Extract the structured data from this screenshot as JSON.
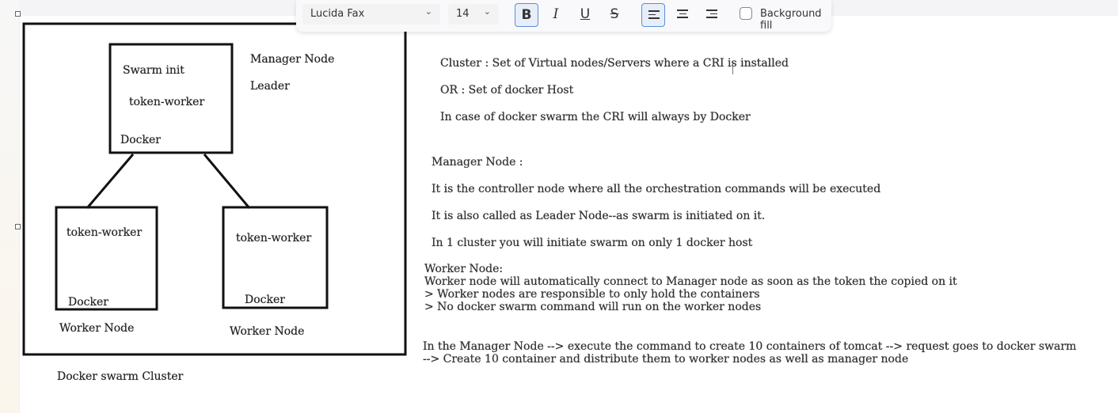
{
  "toolbar": {
    "font_family": "Lucida Fax",
    "font_size": "14",
    "bold_label": "B",
    "italic_label": "I",
    "underline_label": "U",
    "strike_label": "S",
    "background_fill_label": "Background fill",
    "icons": {
      "chevron": "chevron-down-icon",
      "align_left": "align-left-icon",
      "align_center": "align-center-icon",
      "align_right": "align-right-icon"
    },
    "accent_color": "#5b8ddb"
  },
  "diagram": {
    "manager_box": {
      "line1": "Swarm init",
      "line2": "token-worker",
      "line3": "Docker"
    },
    "manager_label": "Manager Node",
    "leader_label": "Leader",
    "worker_left": {
      "line1": "token-worker",
      "line2": "Docker",
      "caption": "Worker Node"
    },
    "worker_right": {
      "line1": "token-worker",
      "line2": "Docker",
      "caption": "Worker Node"
    },
    "cluster_caption": "Docker swarm Cluster"
  },
  "notes": {
    "cluster_def": "Cluster : Set of Virtual nodes/Servers where a CRI is installed",
    "cluster_or": "OR : Set of docker Host",
    "cluster_cri": "In case of docker swarm the CRI will always by Docker",
    "manager_heading": "Manager Node :",
    "manager_1": "It is the controller node where all the orchestration commands will be executed",
    "manager_2": "It is also called as Leader Node--as swarm is initiated on it.",
    "manager_3": "In 1 cluster you will initiate swarm on only 1 docker host",
    "worker_heading": "Worker Node:",
    "worker_1": "Worker node will automatically connect to Manager node as soon as the token the copied on it",
    "worker_2": "> Worker nodes are responsible to only hold the containers",
    "worker_3": "> No docker swarm command will run on the worker nodes",
    "flow_1": "In the Manager Node --> execute the command to create 10 containers of tomcat --> request goes to docker swarm",
    "flow_2": "--> Create 10 container and distribute them to worker nodes as well as manager node"
  }
}
